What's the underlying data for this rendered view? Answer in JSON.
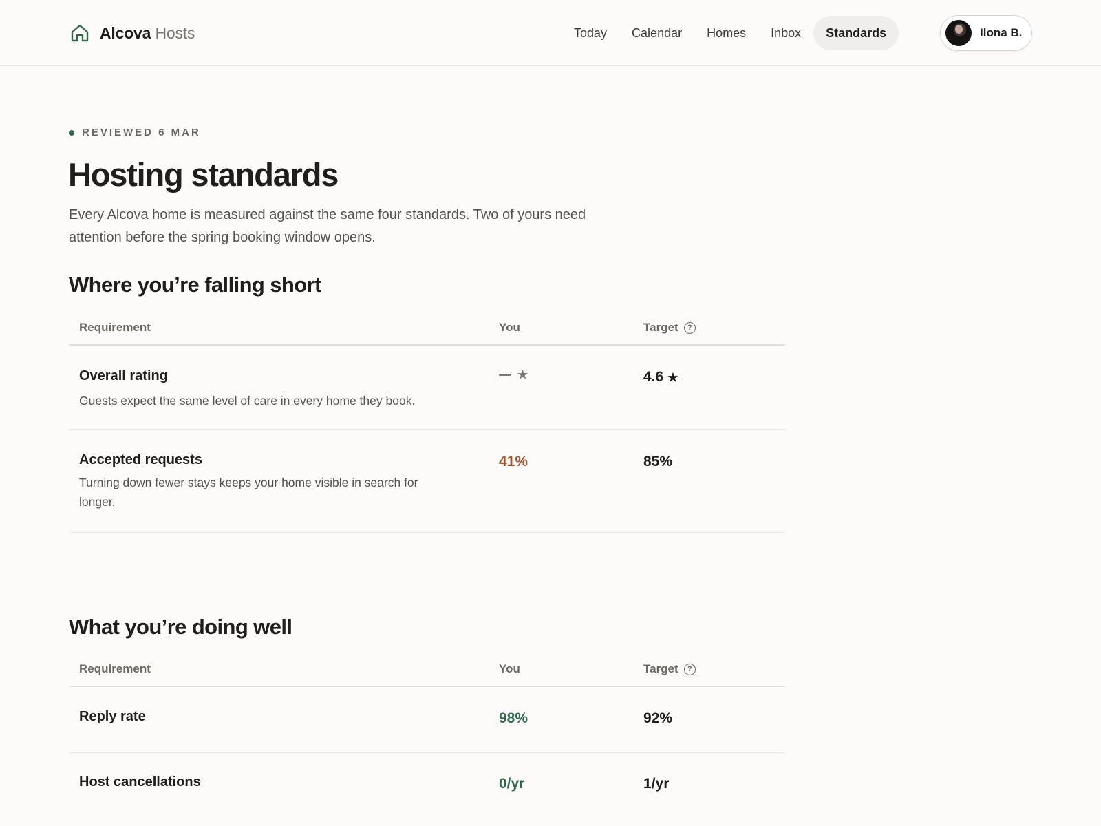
{
  "header": {
    "brand_name": "Alcova",
    "brand_sub": "Hosts",
    "nav": [
      "Today",
      "Calendar",
      "Homes",
      "Inbox",
      "Standards"
    ],
    "active_nav": "Standards",
    "user_name": "Ilona B."
  },
  "page": {
    "eyebrow": "REVIEWED 6 MAR",
    "title": "Hosting standards",
    "intro": "Every Alcova home is measured against the same four standards. Two of yours need attention before the spring booking window opens."
  },
  "falling_short": {
    "title": "Where you’re falling short",
    "columns": {
      "requirement": "Requirement",
      "you": "You",
      "target": "Target"
    },
    "rows": [
      {
        "title": "Overall rating",
        "description": "Guests expect the same level of care in every home they book.",
        "you": "",
        "target": "4.6"
      },
      {
        "title": "Accepted requests",
        "description": "Turning down fewer stays keeps your home visible in search for longer.",
        "you": "41%",
        "target": "85%"
      }
    ]
  },
  "doing_well": {
    "title": "What you’re doing well",
    "columns": {
      "requirement": "Requirement",
      "you": "You",
      "target": "Target"
    },
    "rows": [
      {
        "title": "Reply rate",
        "you": "98%",
        "target": "92%"
      },
      {
        "title": "Host cancellations",
        "you": "0/yr",
        "target": "1/yr"
      }
    ]
  },
  "colors": {
    "accent_green": "#2f6a4c",
    "warning_rust": "#a4552f",
    "background": "#fcfbf9"
  },
  "icons": {
    "brand": "house-outline-icon",
    "help": "question-circle-icon",
    "rating": "star-icon"
  }
}
